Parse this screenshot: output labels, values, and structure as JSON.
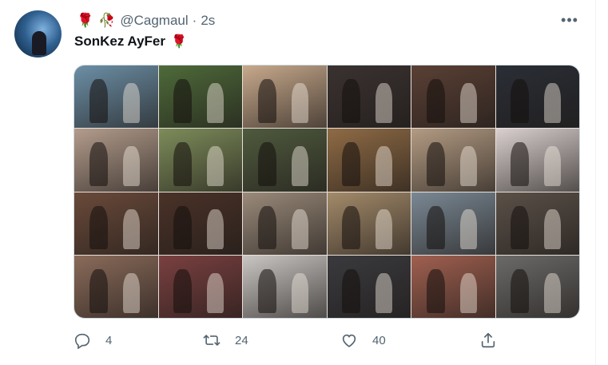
{
  "author": {
    "handle": "@Cagmaul",
    "separator": "·",
    "timestamp": "2s",
    "name_icons": [
      "rose-icon",
      "tulip-icon"
    ]
  },
  "tweet": {
    "text": "SonKez AyFer",
    "trailing_icon": "rose-icon"
  },
  "media": {
    "grid_columns": 6,
    "grid_rows": 4,
    "tiles": [
      {
        "tone": "#6c8fa6"
      },
      {
        "tone": "#4e6a3a"
      },
      {
        "tone": "#c7a98c"
      },
      {
        "tone": "#3a3230"
      },
      {
        "tone": "#5a4035"
      },
      {
        "tone": "#2a2e36"
      },
      {
        "tone": "#b39c8c"
      },
      {
        "tone": "#7d8c5a"
      },
      {
        "tone": "#4f5a3e"
      },
      {
        "tone": "#8f6b45"
      },
      {
        "tone": "#b39b83"
      },
      {
        "tone": "#d9d0cf"
      },
      {
        "tone": "#6a4a3a"
      },
      {
        "tone": "#4a3228"
      },
      {
        "tone": "#9a8a7a"
      },
      {
        "tone": "#a38a6a"
      },
      {
        "tone": "#7a8894"
      },
      {
        "tone": "#5a5048"
      },
      {
        "tone": "#8a6b5a"
      },
      {
        "tone": "#7a4040"
      },
      {
        "tone": "#c9c6c4"
      },
      {
        "tone": "#3a3a3e"
      },
      {
        "tone": "#a06050"
      },
      {
        "tone": "#6b6a68"
      }
    ]
  },
  "actions": {
    "reply_count": "4",
    "retweet_count": "24",
    "like_count": "40"
  },
  "colors": {
    "text_primary": "#0f1419",
    "text_secondary": "#536471",
    "border": "#cfd9de"
  }
}
